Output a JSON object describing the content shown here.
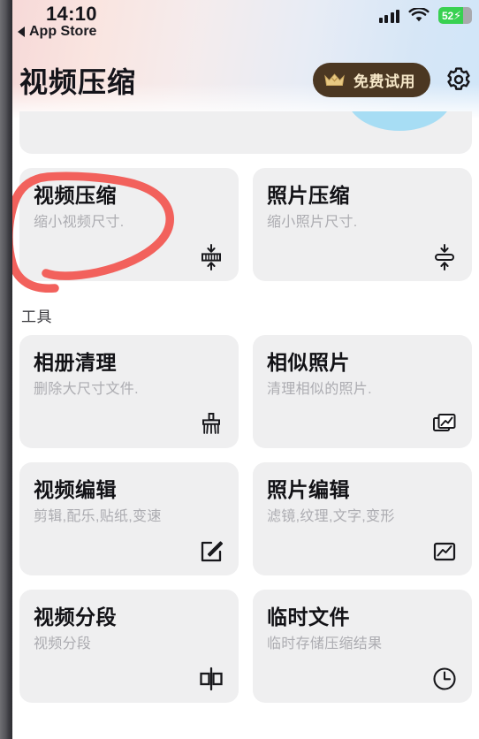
{
  "status_bar": {
    "time": "14:10",
    "back_label": "App Store",
    "signal_icon": "cellular-signal-icon",
    "wifi_icon": "wifi-icon",
    "battery_level": "52",
    "battery_charging": true,
    "battery_color": "#38d151"
  },
  "header": {
    "title": "视频压缩",
    "trial_button": {
      "label": "免费试用",
      "icon": "crown-icon",
      "bg_color": "#4b3722",
      "text_color": "#f6e7c8"
    },
    "settings_icon": "gear-icon"
  },
  "promo_card": {
    "accent_color": "#a7ddf4",
    "shape": "arc-decoration"
  },
  "feature_cards": [
    {
      "title": "视频压缩",
      "subtitle": "缩小视频尺寸.",
      "icon": "compress-video-icon",
      "annotated": true
    },
    {
      "title": "照片压缩",
      "subtitle": "缩小照片尺寸.",
      "icon": "compress-photo-icon",
      "annotated": false
    }
  ],
  "tools_section": {
    "label": "工具",
    "cards": [
      {
        "title": "相册清理",
        "subtitle": "删除大尺寸文件.",
        "icon": "broom-icon"
      },
      {
        "title": "相似照片",
        "subtitle": "清理相似的照片.",
        "icon": "stacked-photos-icon"
      },
      {
        "title": "视频编辑",
        "subtitle": "剪辑,配乐,贴纸,变速",
        "icon": "edit-square-icon"
      },
      {
        "title": "照片编辑",
        "subtitle": "滤镜,纹理,文字,变形",
        "icon": "photo-edit-icon"
      },
      {
        "title": "视频分段",
        "subtitle": "视频分段",
        "icon": "split-video-icon"
      },
      {
        "title": "临时文件",
        "subtitle": "临时存储压缩结果",
        "icon": "clock-icon"
      }
    ]
  },
  "annotation": {
    "type": "hand-drawn-circle",
    "color": "#f2615c",
    "target": "视频压缩"
  },
  "theme": {
    "page_bg": "#ffffff",
    "card_bg": "#efeff0",
    "title_color": "#121216",
    "subtitle_color": "#acacb1"
  }
}
